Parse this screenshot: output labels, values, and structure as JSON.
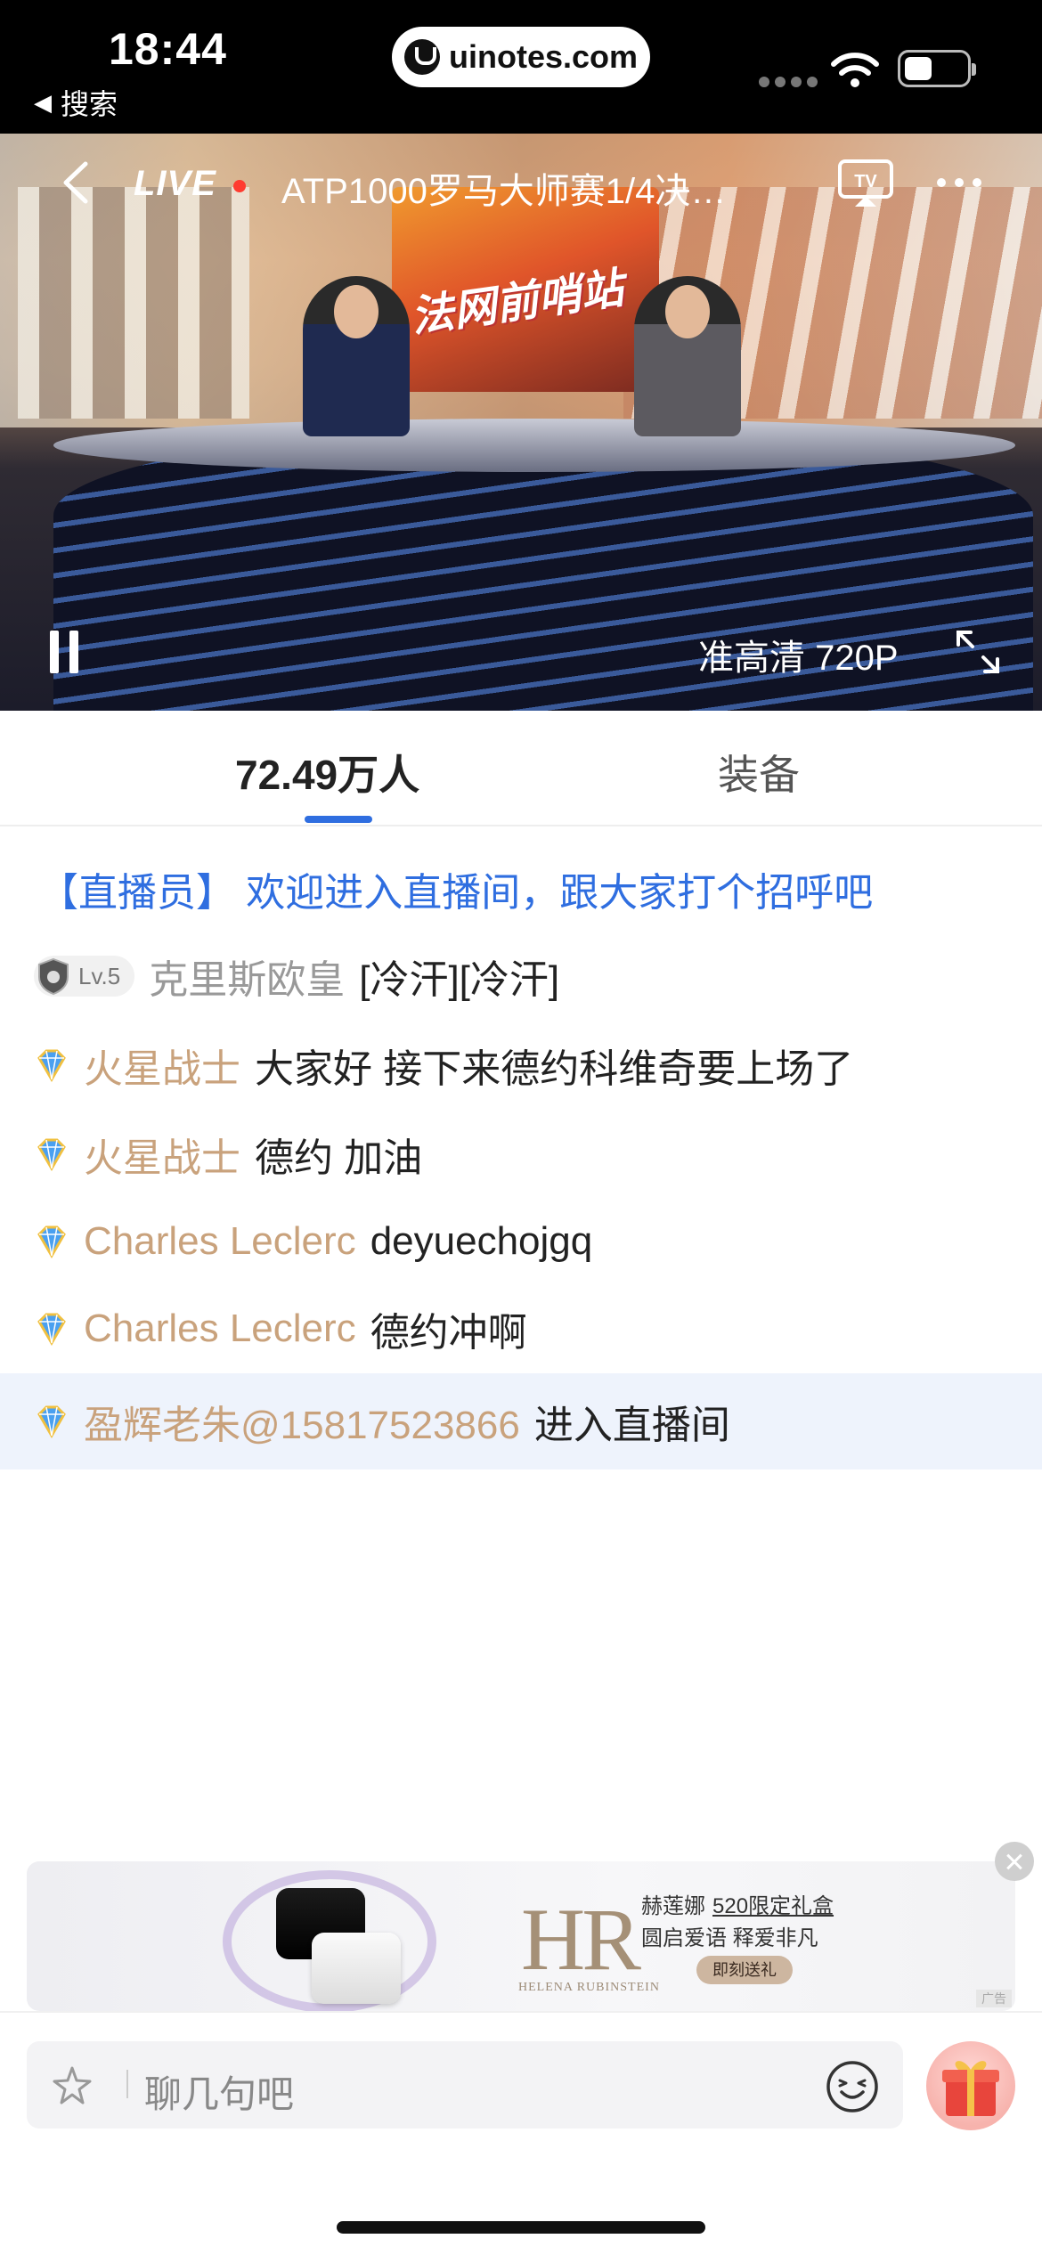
{
  "status_bar": {
    "time": "18:44",
    "back_label": "搜索",
    "url": "uinotes.com"
  },
  "player": {
    "live_label": "LIVE",
    "title": "ATP1000罗马大师赛1/4决…",
    "quality": "准高清 720P",
    "banner_text": "法网前哨站",
    "icons": [
      "back-icon",
      "airplay-tv-icon",
      "more-icon",
      "pause-icon",
      "fullscreen-icon"
    ]
  },
  "tabs": [
    {
      "label": "72.49万人",
      "active": true
    },
    {
      "label": "装备",
      "active": false
    }
  ],
  "chat": {
    "system_message": "【直播员】 欢迎进入直播间，跟大家打个招呼吧",
    "messages": [
      {
        "badge": "Lv.5",
        "user": "克里斯欧皇",
        "text": "[冷汗][冷汗]"
      },
      {
        "badge": "diamond",
        "user": "火星战士",
        "text": "大家好 接下来德约科维奇要上场了"
      },
      {
        "badge": "diamond",
        "user": "火星战士",
        "text": "德约 加油"
      },
      {
        "badge": "diamond",
        "user": "Charles Leclerc",
        "text": "deyuechojgq"
      },
      {
        "badge": "diamond",
        "user": "Charles Leclerc",
        "text": "德约冲啊"
      },
      {
        "badge": "diamond",
        "user": "盈辉老朱@15817523866",
        "text": "进入直播间",
        "highlight": true
      }
    ]
  },
  "ad": {
    "logo": "HR",
    "brand": "HELENA RUBINSTEIN",
    "line1_prefix": "赫莲娜",
    "line1_highlight": "520限定礼盒",
    "line2": "圆启爱语  释爱非凡",
    "cta": "即刻送礼",
    "tag": "广告"
  },
  "input": {
    "placeholder": "聊几句吧"
  },
  "colors": {
    "accent": "#2f6ee0",
    "username": "#c9a27c",
    "highlight_row": "#eef3fc"
  }
}
